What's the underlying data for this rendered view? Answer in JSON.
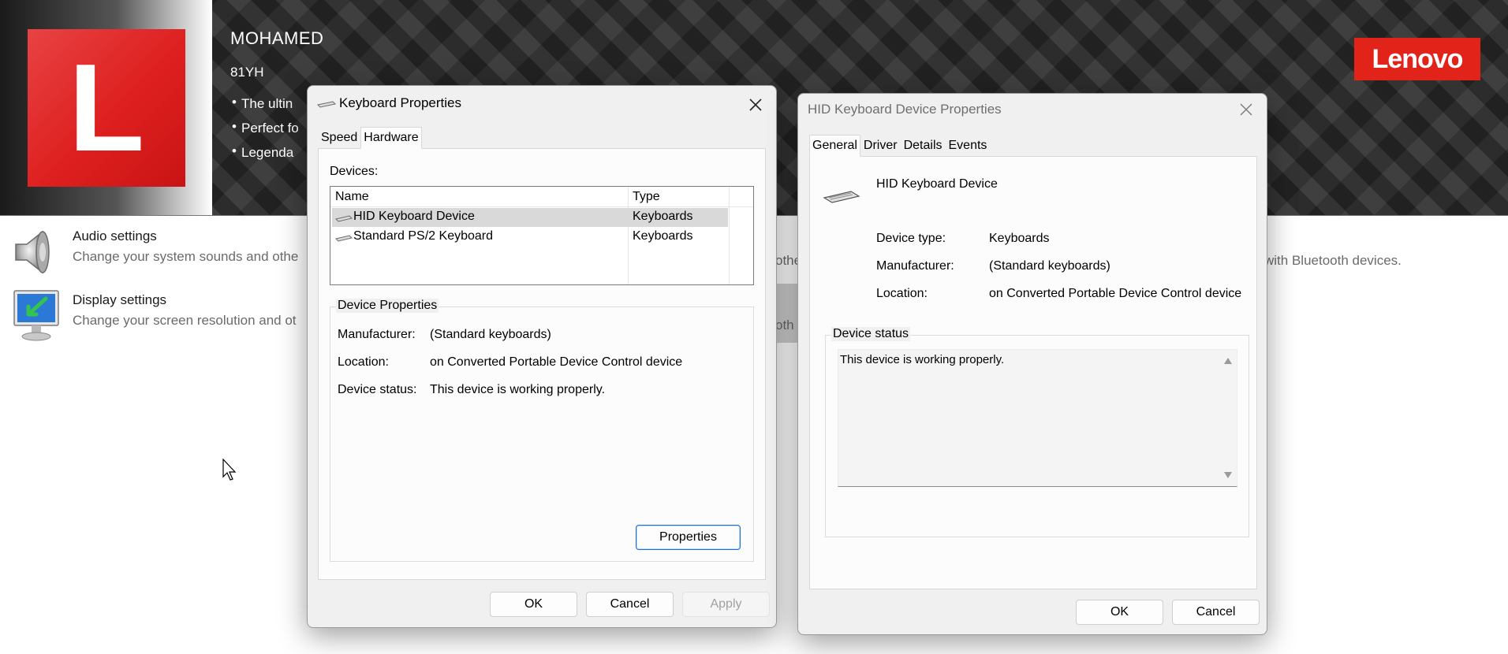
{
  "oem": {
    "logo_letter": "L",
    "owner": "MOHAMED",
    "model": "81YH",
    "bullets": [
      "The ultin",
      "Perfect fo",
      "Legenda"
    ],
    "brand": "Lenovo",
    "brand_color": "#e2231a"
  },
  "control_panel": {
    "items": [
      {
        "title": "Audio settings",
        "desc": "Change your system sounds and othe",
        "icon": "speaker-icon"
      },
      {
        "title": "Display settings",
        "desc": "Change your screen resolution and ot",
        "icon": "display-icon"
      }
    ],
    "fragments": {
      "audio_mid": "othe",
      "display_mid": "oth",
      "bluetooth": "with Bluetooth devices."
    }
  },
  "keyboard_dialog": {
    "title": "Keyboard Properties",
    "tabs": [
      {
        "label": "Speed"
      },
      {
        "label": "Hardware"
      }
    ],
    "active_tab": "Hardware",
    "devices_label": "Devices:",
    "columns": {
      "name": "Name",
      "type": "Type"
    },
    "devices": [
      {
        "name": "HID Keyboard Device",
        "type": "Keyboards",
        "selected": true
      },
      {
        "name": "Standard PS/2 Keyboard",
        "type": "Keyboards",
        "selected": false
      }
    ],
    "group_label": "Device Properties",
    "props": {
      "manufacturer_label": "Manufacturer:",
      "manufacturer": "(Standard keyboards)",
      "location_label": "Location:",
      "location": "on Converted Portable Device Control device",
      "status_label": "Device status:",
      "status": "This device is working properly."
    },
    "properties_button": "Properties",
    "buttons": {
      "ok": "OK",
      "cancel": "Cancel",
      "apply": "Apply"
    }
  },
  "hid_dialog": {
    "title": "HID Keyboard Device Properties",
    "tabs": [
      {
        "label": "General"
      },
      {
        "label": "Driver"
      },
      {
        "label": "Details"
      },
      {
        "label": "Events"
      }
    ],
    "active_tab": "General",
    "device_name": "HID Keyboard Device",
    "info": {
      "type_label": "Device type:",
      "type": "Keyboards",
      "manufacturer_label": "Manufacturer:",
      "manufacturer": "(Standard keyboards)",
      "location_label": "Location:",
      "location": "on Converted Portable Device Control device"
    },
    "status_group": "Device status",
    "status_text": "This device is working properly.",
    "buttons": {
      "ok": "OK",
      "cancel": "Cancel"
    }
  }
}
